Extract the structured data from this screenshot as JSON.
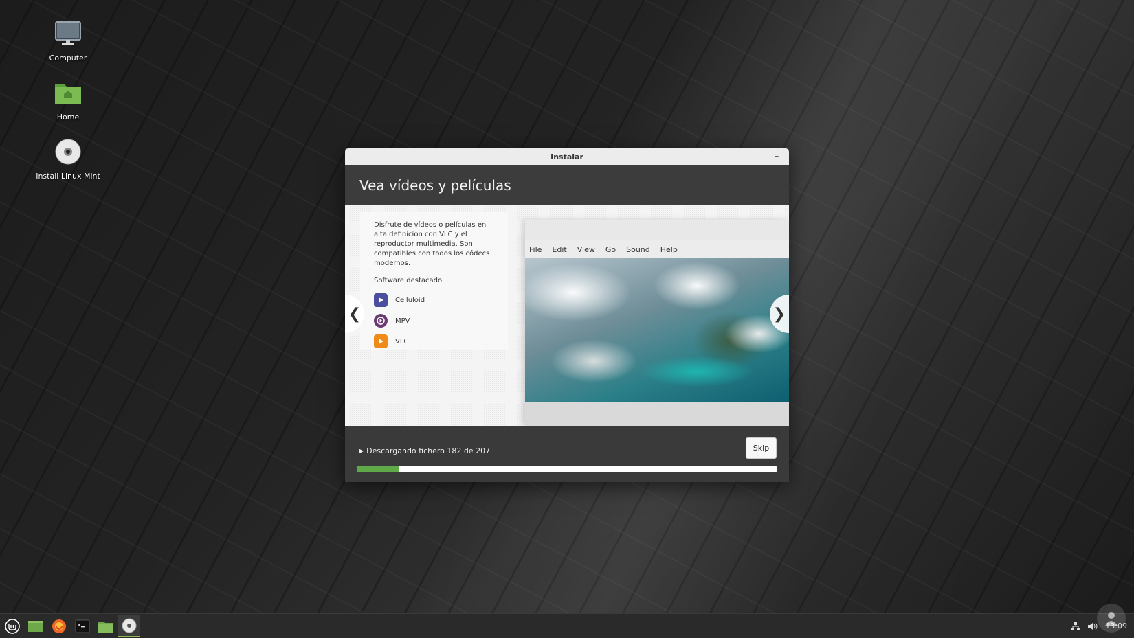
{
  "desktop": {
    "icons": [
      {
        "label": "Computer",
        "icon": "monitor-icon"
      },
      {
        "label": "Home",
        "icon": "home-folder-icon"
      },
      {
        "label": "Install Linux Mint",
        "icon": "disc-icon"
      }
    ]
  },
  "window": {
    "title": "Instalar",
    "minimize_label": "–",
    "heading": "Vea vídeos y películas",
    "description": "Disfrute de vídeos o películas en alta definición con VLC y el reproductor multimedia. Son compatibles con todos los códecs modernos.",
    "featured_title": "Software destacado",
    "apps": [
      {
        "label": "Celluloid",
        "color": "#4c4f9e",
        "icon": "celluloid-icon"
      },
      {
        "label": "MPV",
        "color": "#6a3c72",
        "icon": "mpv-icon"
      },
      {
        "label": "VLC",
        "color": "#f08a18",
        "icon": "vlc-icon"
      }
    ],
    "preview_menu": [
      "File",
      "Edit",
      "View",
      "Go",
      "Sound",
      "Help"
    ],
    "nav_prev": "❮",
    "nav_next": "❯",
    "status": "Descargando fichero 182 de 207",
    "skip_label": "Skip",
    "progress_percent": 10
  },
  "taskbar": {
    "items": [
      "mint-menu-icon",
      "show-desktop-icon",
      "firefox-icon",
      "terminal-icon",
      "files-icon",
      "installer-icon"
    ],
    "time": "13:09"
  },
  "colors": {
    "accent": "#5fa948",
    "window_dark": "#3a3a3a"
  }
}
